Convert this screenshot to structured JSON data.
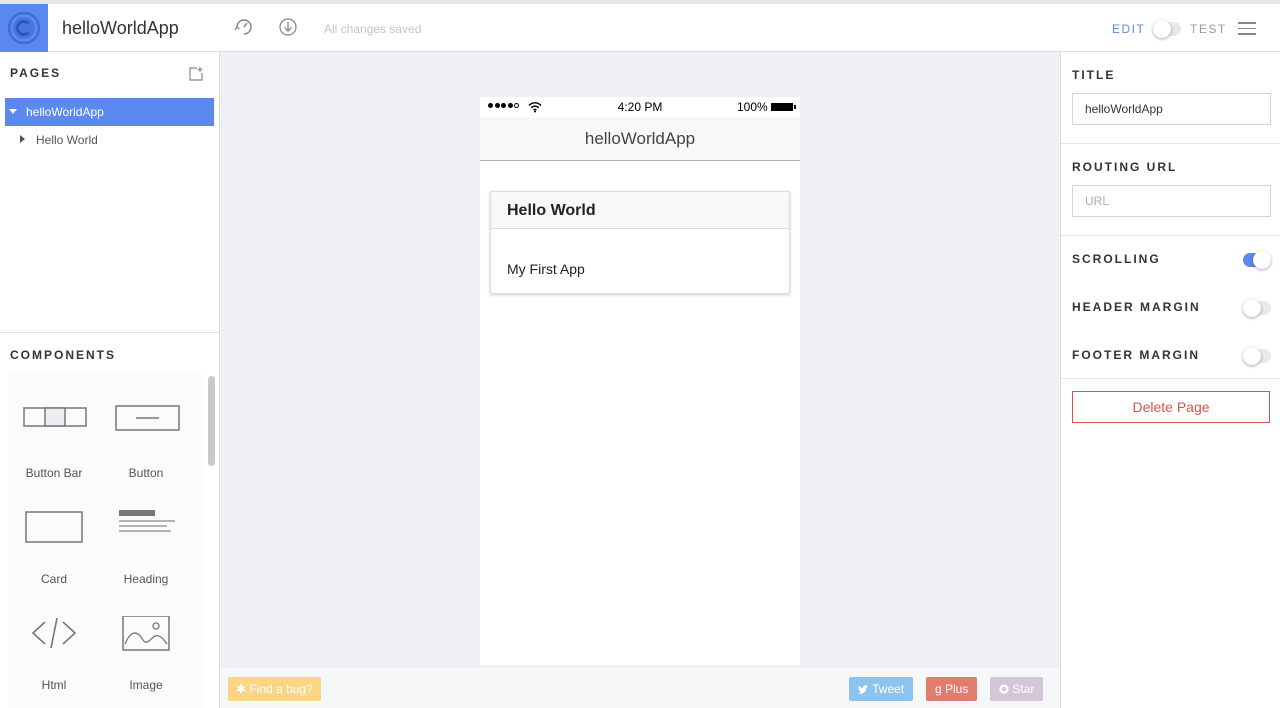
{
  "header": {
    "app_title": "helloWorldApp",
    "save_status": "All changes saved",
    "mode_edit": "EDIT",
    "mode_test": "TEST",
    "accent": "#5b89f0"
  },
  "left": {
    "pages_title": "PAGES",
    "pages": [
      {
        "label": "helloWorldApp",
        "selected": true
      },
      {
        "label": "Hello World",
        "selected": false
      }
    ],
    "components_title": "COMPONENTS",
    "components": [
      {
        "label": "Button Bar",
        "icon": "button-bar-icon"
      },
      {
        "label": "Button",
        "icon": "button-icon"
      },
      {
        "label": "Card",
        "icon": "card-icon"
      },
      {
        "label": "Heading",
        "icon": "heading-icon"
      },
      {
        "label": "Html",
        "icon": "code-icon"
      },
      {
        "label": "Image",
        "icon": "image-icon"
      }
    ]
  },
  "phone": {
    "time": "4:20 PM",
    "battery": "100%",
    "nav_title": "helloWorldApp",
    "card_title": "Hello World",
    "card_body": "My First App"
  },
  "bottom": {
    "bug": "Find a bug?",
    "tweet": "Tweet",
    "plus": "Plus",
    "star": "Star"
  },
  "right": {
    "title_label": "TITLE",
    "title_value": "helloWorldApp",
    "routing_label": "ROUTING URL",
    "routing_placeholder": "URL",
    "scrolling_label": "SCROLLING",
    "scrolling_on": true,
    "header_margin_label": "HEADER MARGIN",
    "header_margin_on": false,
    "footer_margin_label": "FOOTER MARGIN",
    "footer_margin_on": false,
    "delete_label": "Delete Page"
  }
}
